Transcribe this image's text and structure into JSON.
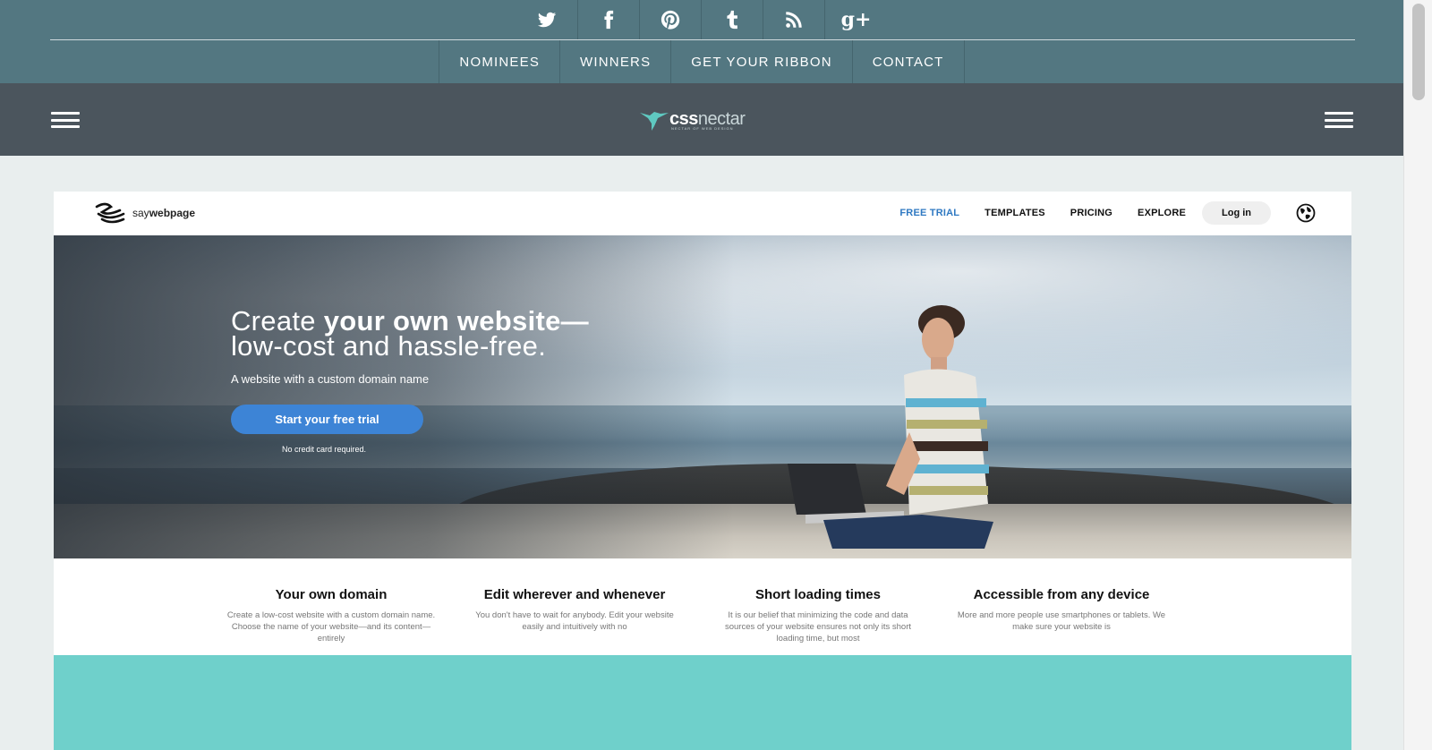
{
  "social": {
    "items": [
      {
        "icon": "twitter-icon"
      },
      {
        "icon": "facebook-icon"
      },
      {
        "icon": "pinterest-icon"
      },
      {
        "icon": "tumblr-icon"
      },
      {
        "icon": "rss-icon"
      },
      {
        "icon": "google-plus-icon",
        "glyph": "g+"
      }
    ]
  },
  "nav": {
    "items": [
      "NOMINEES",
      "WINNERS",
      "GET YOUR RIBBON",
      "CONTACT"
    ]
  },
  "header": {
    "logo_css": "css",
    "logo_nectar": "nectar",
    "logo_tagline": "NECTAR OF WEB DESIGN"
  },
  "site": {
    "logo_prefix": "say",
    "logo_name": "webpage",
    "links": [
      "FREE TRIAL",
      "TEMPLATES",
      "PRICING",
      "EXPLORE"
    ],
    "login": "Log in",
    "hero": {
      "title_light_1": "Create ",
      "title_bold_1": "your own website—",
      "title_line_2": "low-cost and hassle-free.",
      "subtitle": "A website with a custom domain name",
      "cta": "Start your free trial",
      "note": "No credit card required."
    },
    "features": [
      {
        "title": "Your own domain",
        "text": "Create a low-cost website with a custom domain name. Choose the name of your website—and its content—entirely"
      },
      {
        "title": "Edit wherever and whenever",
        "text": "You don't have to wait for anybody. Edit your website easily and intuitively with no"
      },
      {
        "title": "Short loading times",
        "text": "It is our belief that minimizing the code and data sources of your website ensures not only its short loading time, but most"
      },
      {
        "title": "Accessible from any device",
        "text": "More and more people use smartphones or tablets. We make sure your website is"
      }
    ]
  },
  "colors": {
    "topbar": "#537781",
    "header": "#4b555d",
    "accent": "#6fd0cb",
    "cta": "#3d84d6",
    "active_link": "#2f79c2"
  }
}
